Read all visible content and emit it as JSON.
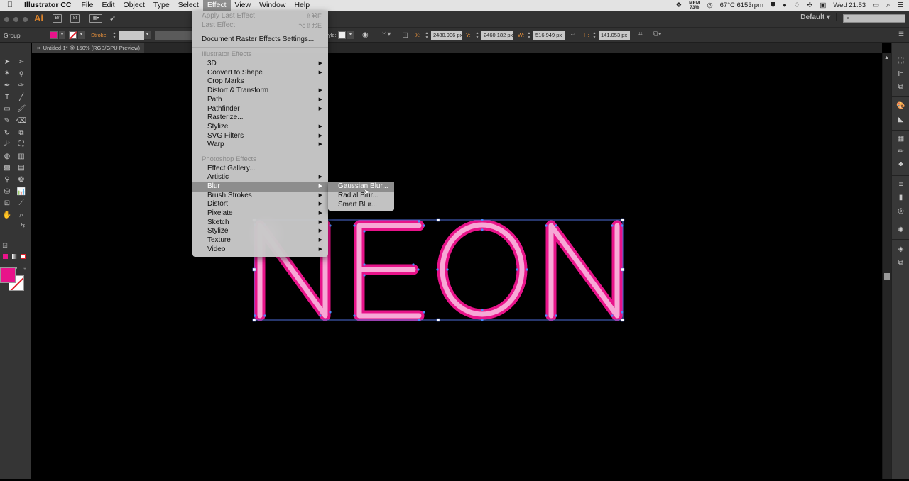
{
  "menubar": {
    "apple_icon": "apple-logo",
    "app_name": "Illustrator CC",
    "items": [
      "File",
      "Edit",
      "Object",
      "Type",
      "Select",
      "Effect",
      "View",
      "Window",
      "Help"
    ],
    "active_item": "Effect",
    "status": {
      "mem_label": "MEM",
      "mem_value": "73%",
      "temp_rpm": "67°C 6153rpm",
      "clock": "Wed 21:53"
    }
  },
  "appbar": {
    "logo": "Ai",
    "bridge_label": "Br",
    "stock_label": "St",
    "workspace": "Default",
    "search_placeholder": ""
  },
  "controlbar": {
    "selection_type": "Group",
    "stroke_label": "Stroke:",
    "style_label": "yle:",
    "x_label": "X:",
    "x_value": "2480.906 px",
    "y_label": "Y:",
    "y_value": "2460.182 px",
    "w_label": "W:",
    "w_value": "516.949 px",
    "h_label": "H:",
    "h_value": "141.053 px",
    "fill_color": "#e8138a"
  },
  "document": {
    "tab_title": "Untitled-1* @ 150% (RGB/GPU Preview)",
    "close_glyph": "×",
    "artwork_text": "NEON",
    "neon_outer": "#e8138a",
    "neon_inner": "#f7a8d6"
  },
  "effect_menu": {
    "apply_last": {
      "label": "Apply Last Effect",
      "shortcut": "⇧⌘E"
    },
    "last": {
      "label": "Last Effect",
      "shortcut": "⌥⇧⌘E"
    },
    "doc_raster": "Document Raster Effects Settings...",
    "illustrator_header": "Illustrator Effects",
    "illustrator_items": [
      {
        "label": "3D",
        "sub": true
      },
      {
        "label": "Convert to Shape",
        "sub": true
      },
      {
        "label": "Crop Marks",
        "sub": false
      },
      {
        "label": "Distort & Transform",
        "sub": true
      },
      {
        "label": "Path",
        "sub": true
      },
      {
        "label": "Pathfinder",
        "sub": true
      },
      {
        "label": "Rasterize...",
        "sub": false
      },
      {
        "label": "Stylize",
        "sub": true
      },
      {
        "label": "SVG Filters",
        "sub": true
      },
      {
        "label": "Warp",
        "sub": true
      }
    ],
    "photoshop_header": "Photoshop Effects",
    "photoshop_items": [
      {
        "label": "Effect Gallery...",
        "sub": false
      },
      {
        "label": "Artistic",
        "sub": true
      },
      {
        "label": "Blur",
        "sub": true
      },
      {
        "label": "Brush Strokes",
        "sub": true
      },
      {
        "label": "Distort",
        "sub": true
      },
      {
        "label": "Pixelate",
        "sub": true
      },
      {
        "label": "Sketch",
        "sub": true
      },
      {
        "label": "Stylize",
        "sub": true
      },
      {
        "label": "Texture",
        "sub": true
      },
      {
        "label": "Video",
        "sub": true
      }
    ],
    "highlighted": "Blur",
    "arrow": "▶"
  },
  "blur_submenu": {
    "items": [
      "Gaussian Blur...",
      "Radial Blur...",
      "Smart Blur..."
    ],
    "highlighted": "Gaussian Blur..."
  },
  "scroll": {
    "up_arrow": "▲"
  }
}
